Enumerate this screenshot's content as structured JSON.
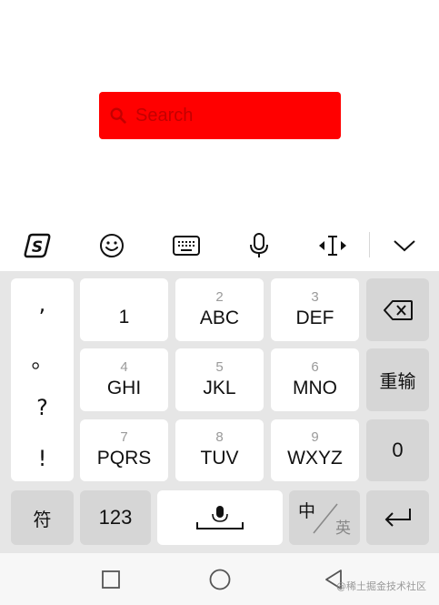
{
  "search": {
    "placeholder": "Search",
    "background": "#ff0000"
  },
  "toolbar": {
    "items": [
      "sogou-logo-icon",
      "emoji-icon",
      "keyboard-icon",
      "microphone-icon",
      "cursor-move-icon",
      "chevron-down-icon"
    ]
  },
  "keyboard": {
    "punctuation": [
      ",",
      "。",
      "?",
      "!"
    ],
    "keys": [
      {
        "num": "",
        "letters": "1"
      },
      {
        "num": "2",
        "letters": "ABC"
      },
      {
        "num": "3",
        "letters": "DEF"
      },
      {
        "num": "4",
        "letters": "GHI"
      },
      {
        "num": "5",
        "letters": "JKL"
      },
      {
        "num": "6",
        "letters": "MNO"
      },
      {
        "num": "7",
        "letters": "PQRS"
      },
      {
        "num": "8",
        "letters": "TUV"
      },
      {
        "num": "9",
        "letters": "WXYZ"
      }
    ],
    "reenter_label": "重输",
    "zero_label": "0",
    "symbols_label": "符",
    "numbers_label": "123",
    "lang_primary": "中",
    "lang_secondary": "英"
  },
  "navbar": {
    "watermark": "@稀土掘金技术社区"
  }
}
